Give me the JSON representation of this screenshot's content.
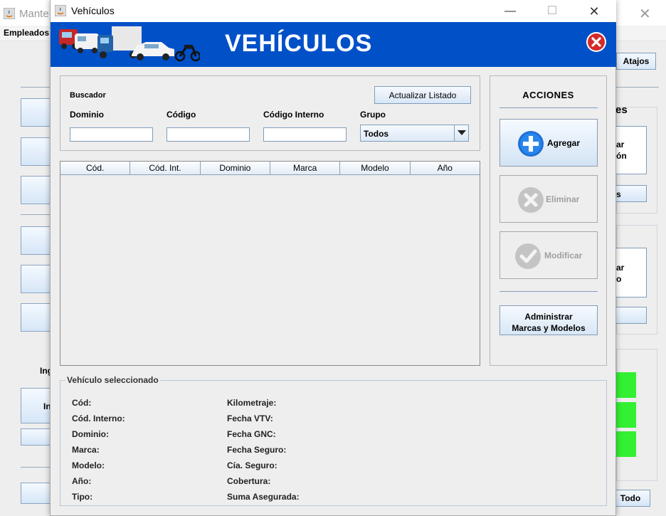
{
  "background": {
    "title": "Mante",
    "menu": [
      "Empleados"
    ],
    "atajos_label": "Atajos",
    "left_text_in": "Ing",
    "left_text_in2": "In",
    "right_fragments": [
      "es",
      "ar",
      "ón",
      "s",
      "ar",
      "o"
    ],
    "todo_label": "Todo"
  },
  "dialog": {
    "title": "Vehículos",
    "banner_title": "VEHÍCULOS",
    "controls": {
      "minimize": "—",
      "maximize": "☐",
      "close": "✕"
    },
    "search": {
      "heading": "Buscador",
      "refresh_label": "Actualizar Listado",
      "fields": {
        "dominio": {
          "label": "Dominio",
          "value": ""
        },
        "codigo": {
          "label": "Código",
          "value": ""
        },
        "codigo_interno": {
          "label": "Código Interno",
          "value": ""
        },
        "grupo": {
          "label": "Grupo",
          "value": "Todos"
        }
      }
    },
    "table": {
      "columns": [
        "Cód.",
        "Cód. Int.",
        "Dominio",
        "Marca",
        "Modelo",
        "Año"
      ],
      "rows": []
    },
    "acciones": {
      "title": "ACCIONES",
      "agregar": "Agregar",
      "eliminar": "Eliminar",
      "modificar": "Modificar",
      "admin_line1": "Administrar",
      "admin_line2": "Marcas y Modelos"
    },
    "seleccionado": {
      "legend": "Vehículo seleccionado",
      "left_labels": [
        "Cód:",
        "Cód. Interno:",
        "Dominio:",
        "Marca:",
        "Modelo:",
        "Año:",
        "Tipo:"
      ],
      "right_labels": [
        "Kilometraje:",
        "Fecha VTV:",
        "Fecha GNC:",
        "Fecha Seguro:",
        "Cía. Seguro:",
        "Cobertura:",
        "Suma Asegurada:"
      ]
    }
  },
  "colors": {
    "banner": "#0050c8",
    "close_red": "#d42a2a",
    "add_blue": "#1f6fd6",
    "green": "#33f033"
  },
  "icons": [
    "java-icon",
    "truck-icon",
    "close-red-icon",
    "plus-icon",
    "x-icon",
    "check-icon",
    "dropdown-arrow-icon"
  ]
}
